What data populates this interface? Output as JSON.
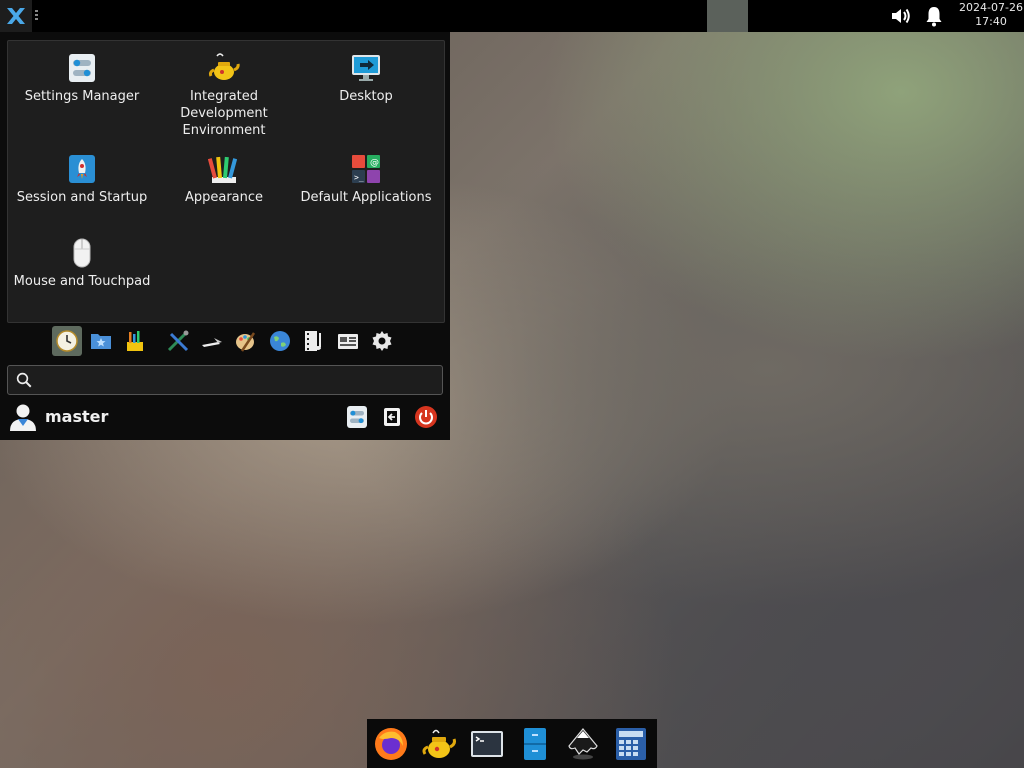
{
  "top_panel": {
    "clock_date": "2024-07-26",
    "clock_time": "17:40",
    "icons": [
      "whisker-menu-icon",
      "volume-icon",
      "notification-bell-icon"
    ]
  },
  "menu": {
    "apps": [
      {
        "label": "Settings Manager",
        "icon": "settings-manager-icon"
      },
      {
        "label": "Integrated Development Environment",
        "icon": "ide-teapot-icon"
      },
      {
        "label": "Desktop",
        "icon": "desktop-icon"
      },
      {
        "label": "Session and Startup",
        "icon": "session-startup-icon"
      },
      {
        "label": "Appearance",
        "icon": "appearance-icon"
      },
      {
        "label": "Default Applications",
        "icon": "default-applications-icon"
      },
      {
        "label": "Mouse and Touchpad",
        "icon": "mouse-icon"
      }
    ],
    "favorites_icons": [
      "recently-used-icon",
      "favorites-folder-icon",
      "accessories-icon",
      "development-icon",
      "education-icon",
      "graphics-icon",
      "internet-icon",
      "multimedia-icon",
      "office-icon",
      "settings-gear-icon"
    ],
    "search_placeholder": "",
    "user": "master"
  },
  "dock": {
    "icons": [
      "firefox-icon",
      "ide-teapot-icon",
      "terminal-icon",
      "file-manager-icon",
      "inkscape-icon",
      "calculator-icon"
    ]
  }
}
